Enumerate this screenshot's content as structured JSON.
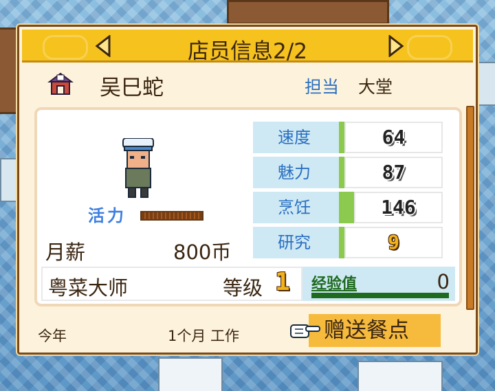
{
  "title": "店员信息2/2",
  "staff": {
    "name": "吴巳蛇",
    "role_label": "担当",
    "role_value": "大堂"
  },
  "stamina": {
    "label": "活力",
    "level": 1.0
  },
  "salary": {
    "label": "月薪",
    "value": "800币"
  },
  "stats": [
    {
      "label": "速度",
      "value": "64"
    },
    {
      "label": "魅力",
      "value": "87"
    },
    {
      "label": "烹饪",
      "value": "146"
    },
    {
      "label": "研究",
      "value": "9"
    }
  ],
  "rank": {
    "name": "粤菜大师",
    "level_label": "等级",
    "level_value": "1"
  },
  "experience": {
    "label": "经验值",
    "value": "0"
  },
  "footer": {
    "year_label": "今年",
    "work_months": "1个月 工作",
    "gift_button": "赠送餐点"
  },
  "colors": {
    "title_bar": "#f6c21e",
    "stat_label_bg": "#cfe9f4",
    "accent_blue": "#2a6fc0",
    "button": "#f6ba3c"
  },
  "icons": {
    "prev": "arrow-left-icon",
    "next": "arrow-right-icon",
    "shop": "shop-icon",
    "hand": "pointing-hand-icon"
  }
}
